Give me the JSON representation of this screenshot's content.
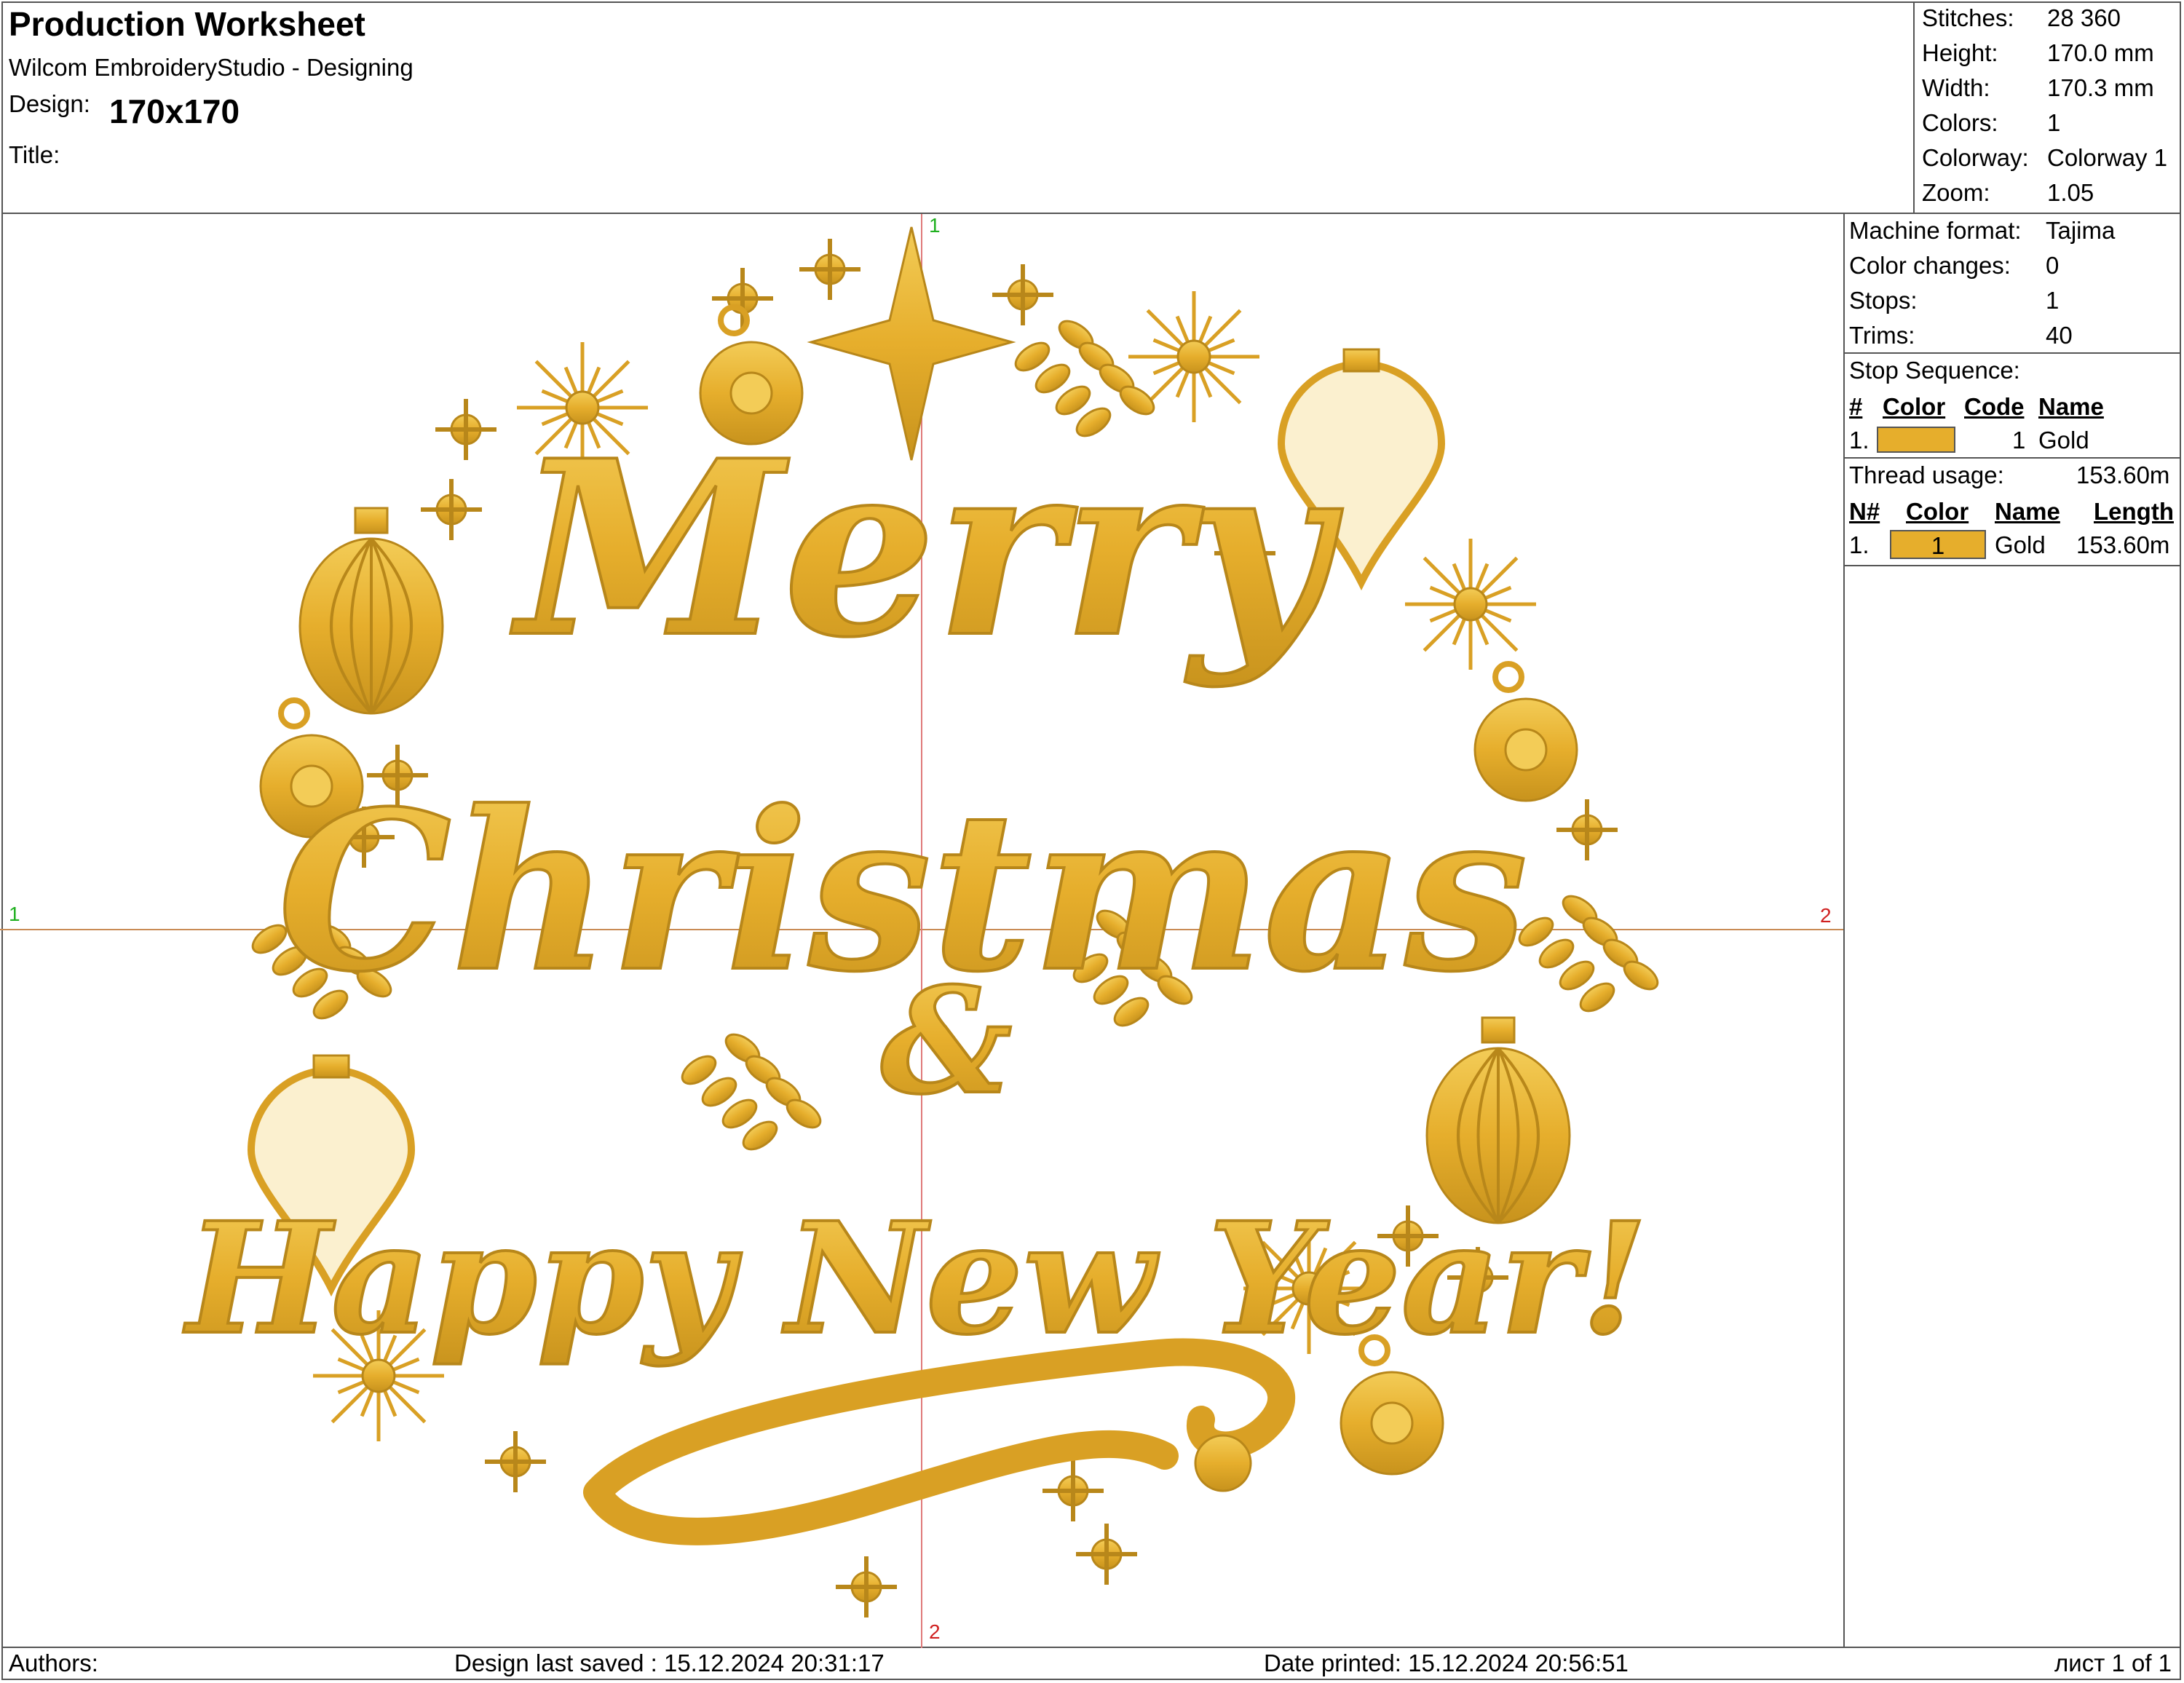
{
  "header": {
    "title": "Production Worksheet",
    "app": "Wilcom EmbroideryStudio - Designing",
    "design_label": "Design:",
    "design_value": "170x170",
    "title_label": "Title:"
  },
  "summary": [
    {
      "label": "Stitches:",
      "value": "28 360"
    },
    {
      "label": "Height:",
      "value": "170.0 mm"
    },
    {
      "label": "Width:",
      "value": "170.3 mm"
    },
    {
      "label": "Colors:",
      "value": "1"
    },
    {
      "label": "Colorway:",
      "value": "Colorway 1"
    },
    {
      "label": "Zoom:",
      "value": "1.05"
    }
  ],
  "machine": [
    {
      "label": "Machine format:",
      "value": "Tajima"
    },
    {
      "label": "Color changes:",
      "value": "0"
    },
    {
      "label": "Stops:",
      "value": "1"
    },
    {
      "label": "Trims:",
      "value": "40"
    }
  ],
  "stop_sequence": {
    "title": "Stop Sequence:",
    "headers": [
      "#",
      "Color",
      "Code",
      "Name"
    ],
    "rows": [
      {
        "num": "1.",
        "color": "#E6AE2C",
        "code": "1",
        "name": "Gold"
      }
    ]
  },
  "thread_usage": {
    "label": "Thread usage:",
    "value": "153.60m",
    "headers": [
      "N#",
      "Color",
      "Name",
      "Length"
    ],
    "rows": [
      {
        "num": "1.",
        "color": "#E6AE2C",
        "color_label": "1",
        "name": "Gold",
        "length": "153.60m"
      }
    ]
  },
  "design": {
    "line1": "Merry",
    "line2": "Christmas",
    "amp": "&",
    "line3": "Happy New Year!",
    "thread_color": "#E6AE2C",
    "shade_color": "#B8871A"
  },
  "markers": {
    "top": "1",
    "left": "1",
    "right": "2",
    "bottom": "2"
  },
  "footer": {
    "authors": "Authors:",
    "saved": "Design last saved : 15.12.2024 20:31:17",
    "printed": "Date printed: 15.12.2024 20:56:51",
    "page": "лист 1 of 1"
  }
}
